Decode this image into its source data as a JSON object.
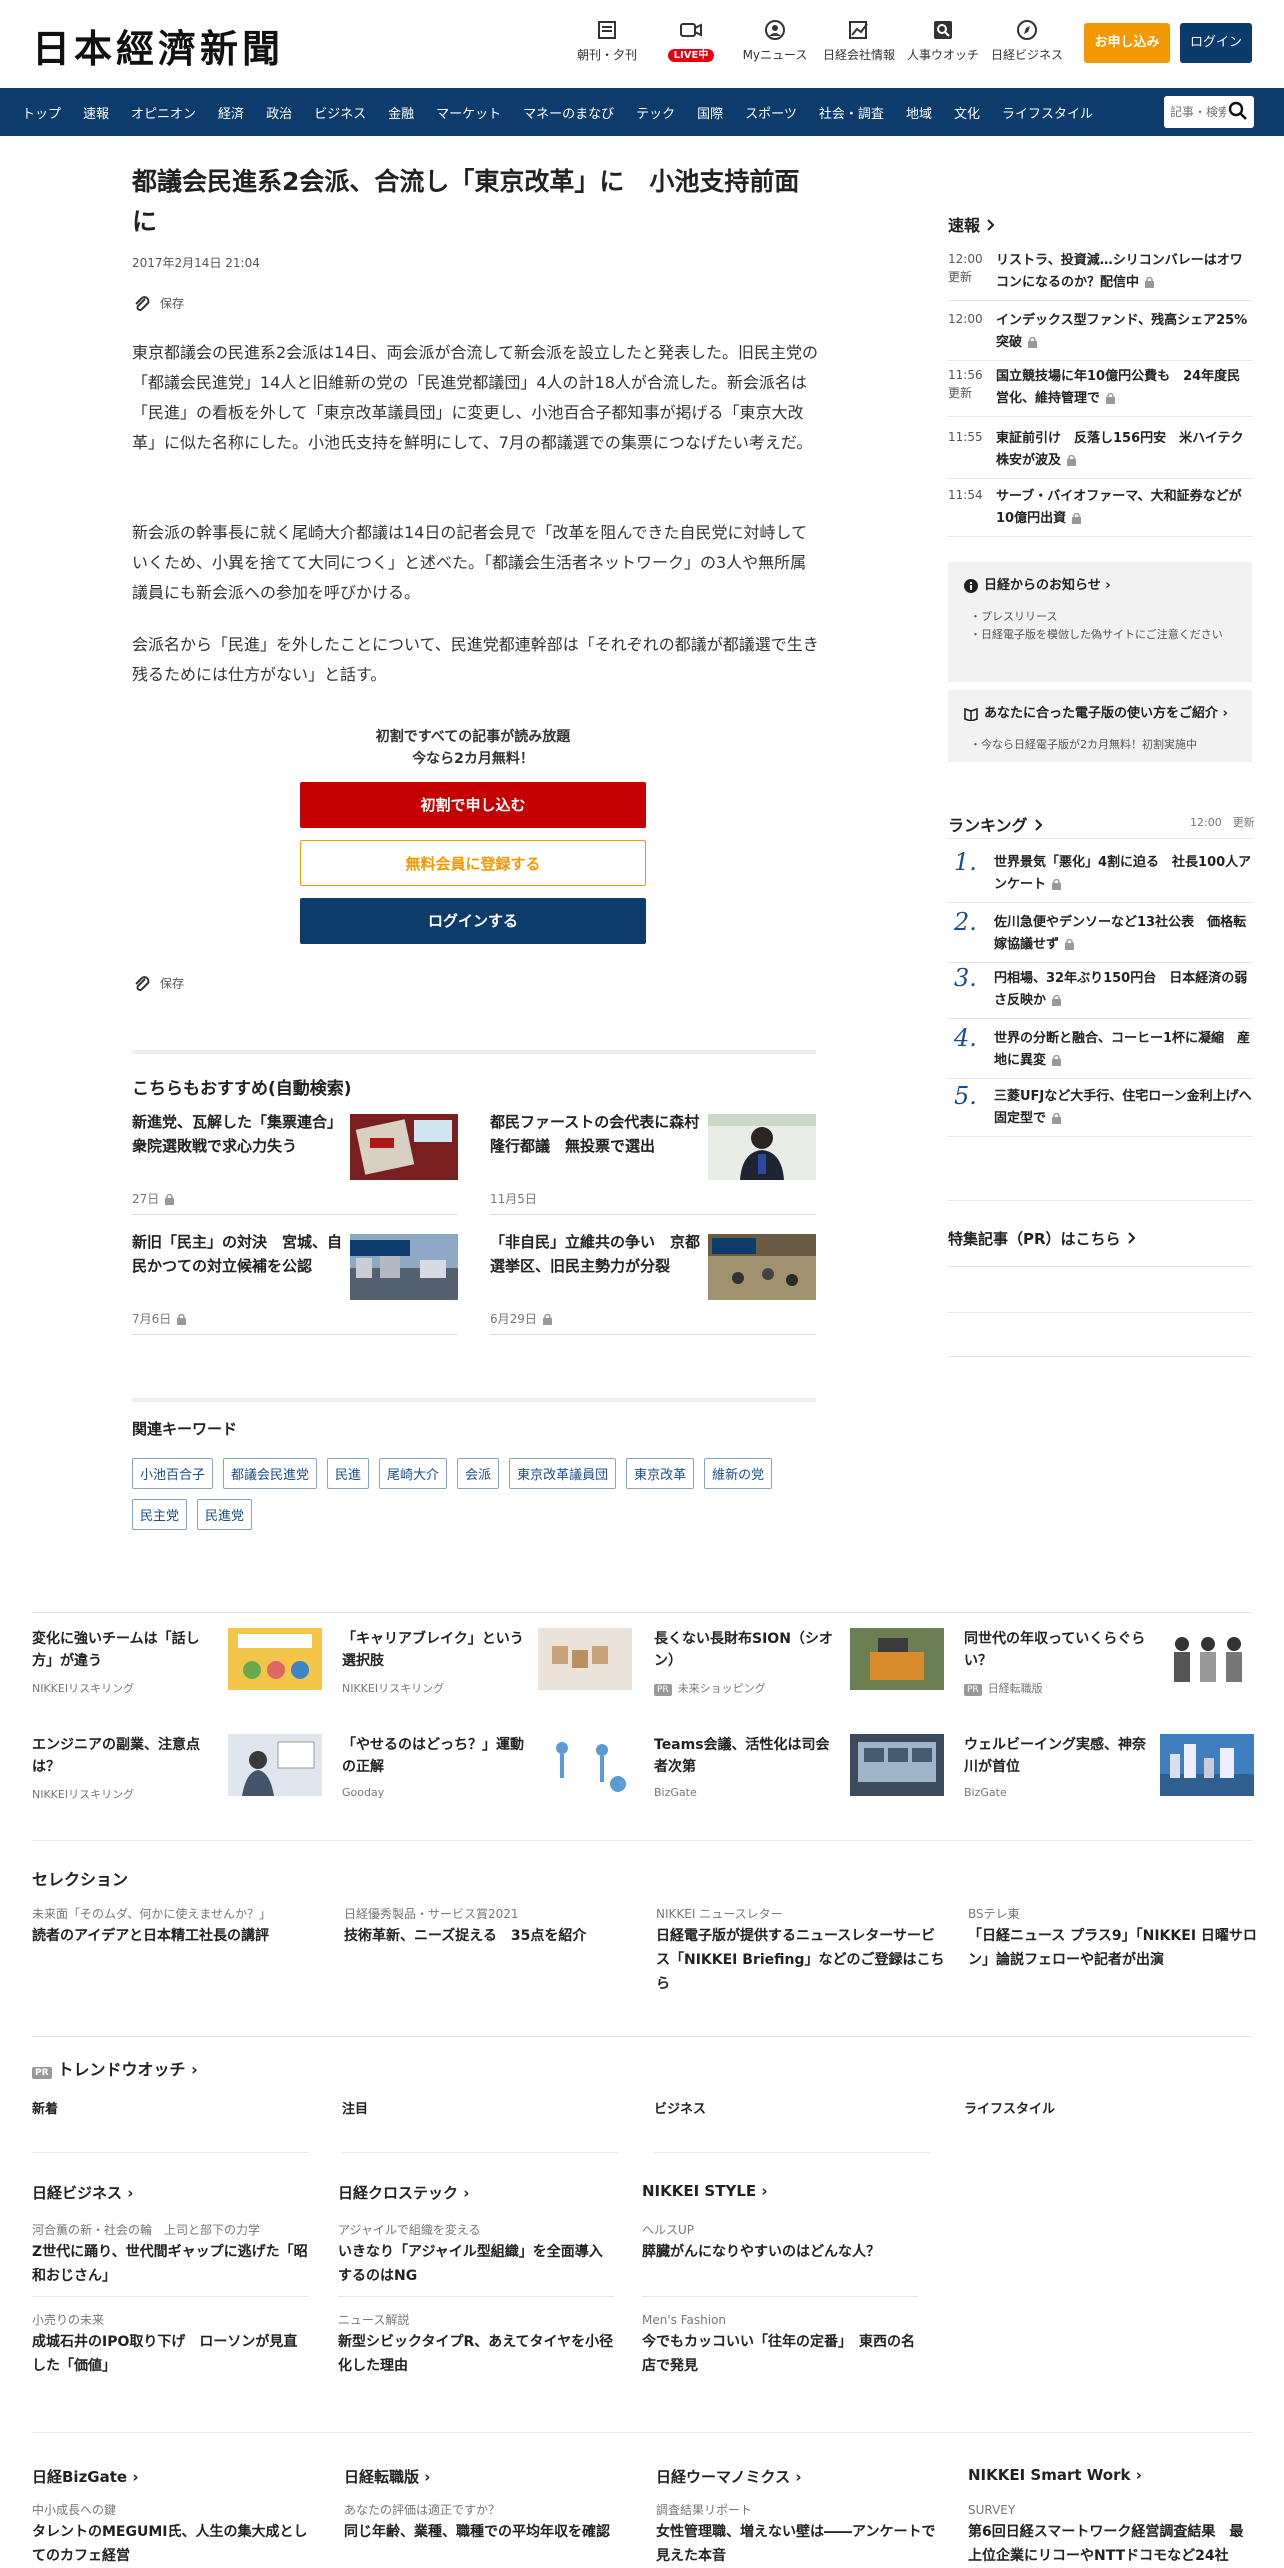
{
  "header": {
    "logo": "日本經濟新聞",
    "icons": [
      {
        "label": "朝刊・夕刊",
        "icon": "newspaper-icon"
      },
      {
        "label": "LIVE中",
        "icon": "video-icon"
      },
      {
        "label": "Myニュース",
        "icon": "user-icon"
      },
      {
        "label": "日経会社情報",
        "icon": "chart-icon"
      },
      {
        "label": "人事ウオッチ",
        "icon": "search-person-icon"
      },
      {
        "label": "日経ビジネス",
        "icon": "compass-icon"
      }
    ],
    "subscribe_label": "お申し込み",
    "login_label": "ログイン"
  },
  "nav": {
    "items": [
      "トップ",
      "速報",
      "オピニオン",
      "経済",
      "政治",
      "ビジネス",
      "金融",
      "マーケット",
      "マネーのまなび",
      "テック",
      "国際",
      "スポーツ",
      "社会・調査",
      "地域",
      "文化",
      "ライフスタイル"
    ],
    "search_placeholder": "記事・検索"
  },
  "article": {
    "title": "都議会民進系2会派、合流し「東京改革」に　小池支持前面に",
    "date": "2017年2月14日 21:04",
    "save_label": "保存",
    "paragraphs": [
      "東京都議会の民進系2会派は14日、両会派が合流して新会派を設立したと発表した。旧民主党の「都議会民進党」14人と旧維新の党の「民進党都議団」4人の計18人が合流した。新会派名は「民進」の看板を外して「東京改革議員団」に変更し、小池百合子都知事が掲げる「東京大改革」に似た名称にした。小池氏支持を鮮明にして、7月の都議選での集票につなげたい考えだ。",
      "新会派の幹事長に就く尾崎大介都議は14日の記者会見で「改革を阻んできた自民党に対峙していくため、小異を捨てて大同につく」と述べた。「都議会生活者ネットワーク」の3人や無所属議員にも新会派への参加を呼びかける。",
      "会派名から「民進」を外したことについて、民進党都連幹部は「それぞれの都議が都議選で生き残るためには仕方がない」と話す。"
    ]
  },
  "paywall": {
    "lead_1": "初割ですべての記事が読み放題",
    "lead_2": "今なら2カ月無料！",
    "subscribe": "初割で申し込む",
    "register": "無料会員に登録する",
    "login": "ログインする"
  },
  "recommend": {
    "heading": "こちらもおすすめ(自動検索)",
    "items": [
      {
        "title": "新進党、瓦解した「集票連合」　衆院選敗戦で求心力失う",
        "date": "27日"
      },
      {
        "title": "都民ファーストの会代表に森村隆行都議　無投票で選出",
        "date": "11月5日"
      },
      {
        "title": "新旧「民主」の対決　宮城、自民かつての対立候補を公認",
        "date": "7月6日"
      },
      {
        "title": "「非自民」立維共の争い　京都選挙区、旧民主勢力が分裂",
        "date": "6月29日"
      }
    ]
  },
  "keywords": {
    "heading": "関連キーワード",
    "items": [
      "小池百合子",
      "都議会民進党",
      "民進",
      "尾崎大介",
      "会派",
      "東京改革議員団",
      "東京改革",
      "維新の党",
      "民主党",
      "民進党"
    ]
  },
  "sidebar": {
    "flash_heading": "速報",
    "flash": [
      {
        "time": "12:00",
        "sub": "更新",
        "title": "リストラ、投資減…シリコンバレーはオワコンになるのか？配信中"
      },
      {
        "time": "12:00",
        "sub": "",
        "title": "インデックス型ファンド、残高シェア25%突破"
      },
      {
        "time": "11:56",
        "sub": "更新",
        "title": "国立競技場に年10億円公費も　24年度民営化、維持管理で"
      },
      {
        "time": "11:55",
        "sub": "",
        "title": "東証前引け　反落し156円安　米ハイテク株安が波及"
      },
      {
        "time": "11:54",
        "sub": "",
        "title": "サーブ・バイオファーマ、大和証券などが10億円出資"
      }
    ],
    "notice_heading": "日経からのお知らせ",
    "notices": [
      "プレスリリース",
      "日経電子版を模倣した偽サイトにご注意ください"
    ],
    "guide_heading": "あなたに合った電子版の使い方をご紹介",
    "guide_items": [
      "今なら日経電子版が2カ月無料！初割実施中"
    ],
    "ranking_heading": "ランキング",
    "ranking_time": "12:00　更新",
    "ranking": [
      {
        "n": "1.",
        "title": "世界景気「悪化」4割に迫る　社長100人アンケート"
      },
      {
        "n": "2.",
        "title": "佐川急便やデンソーなど13社公表　価格転嫁協議せず"
      },
      {
        "n": "3.",
        "title": "円相場、32年ぶり150円台　日本経済の弱さ反映か"
      },
      {
        "n": "4.",
        "title": "世界の分断と融合、コーヒー1杯に凝縮　産地に異変"
      },
      {
        "n": "5.",
        "title": "三菱UFJなど大手行、住宅ローン金利上げへ　固定型で"
      }
    ],
    "special_heading": "特集記事（PR）はこちら"
  },
  "ads": [
    {
      "title": "変化に強いチームは「話し方」が違う",
      "source": "NIKKEIリスキリング",
      "pr": false
    },
    {
      "title": "「キャリアブレイク」という選択肢",
      "source": "NIKKEIリスキリング",
      "pr": false
    },
    {
      "title": "長くない長財布SION（シオン）",
      "source": "未来ショッピング",
      "pr": true
    },
    {
      "title": "同世代の年収っていくらぐらい？",
      "source": "日経転職版",
      "pr": true
    },
    {
      "title": "エンジニアの副業、注意点は？",
      "source": "NIKKEIリスキリング",
      "pr": false
    },
    {
      "title": "「やせるのはどっち？」運動の正解",
      "source": "Gooday",
      "pr": false
    },
    {
      "title": "Teams会議、活性化は司会者次第",
      "source": "BizGate",
      "pr": false
    },
    {
      "title": "ウェルビーイング実感、神奈川が首位",
      "source": "BizGate",
      "pr": false
    }
  ],
  "selection": {
    "heading": "セレクション",
    "items": [
      {
        "kicker": "未来面「そのムダ、何かに使えませんか？」",
        "title": "読者のアイデアと日本精工社長の講評"
      },
      {
        "kicker": "日経優秀製品・サービス賞2021",
        "title": "技術革新、ニーズ捉える　35点を紹介"
      },
      {
        "kicker": "NIKKEI ニュースレター",
        "title": "日経電子版が提供するニュースレターサービス「NIKKEI Briefing」などのご登録はこちら"
      },
      {
        "kicker": "BSテレ東",
        "title": "「日経ニュース プラス9」「NIKKEI 日曜サロン」論説フェローや記者が出演"
      }
    ]
  },
  "trend": {
    "pr": "PR",
    "heading": "トレンドウオッチ",
    "tabs": [
      "新着",
      "注目",
      "ビジネス",
      "ライフスタイル"
    ]
  },
  "media1": [
    {
      "heading": "日経ビジネス",
      "items": [
        {
          "kicker": "河合薫の新・社会の輪　上司と部下の力学",
          "title": "Z世代に踊り、世代間ギャップに逃げた「昭和おじさん」"
        },
        {
          "kicker": "小売りの未来",
          "title": "成城石井のIPO取り下げ　ローソンが見直した「価値」"
        }
      ]
    },
    {
      "heading": "日経クロステック",
      "items": [
        {
          "kicker": "アジャイルで組織を変える",
          "title": "いきなり「アジャイル型組織」を全面導入するのはNG"
        },
        {
          "kicker": "ニュース解説",
          "title": "新型シビックタイプR、あえてタイヤを小径化した理由"
        }
      ]
    },
    {
      "heading": "NIKKEI STYLE",
      "items": [
        {
          "kicker": "ヘルスUP",
          "title": "膵臓がんになりやすいのはどんな人？"
        },
        {
          "kicker": "Men's Fashion",
          "title": "今でもカッコいい「往年の定番」　東西の名店で発見"
        }
      ]
    }
  ],
  "media2": [
    {
      "heading": "日経BizGate",
      "kicker": "中小成長への鍵",
      "title": "タレントのMEGUMI氏、人生の集大成としてのカフェ経営"
    },
    {
      "heading": "日経転職版",
      "kicker": "あなたの評価は適正ですか？",
      "title": "同じ年齢、業種、職種での平均年収を確認"
    },
    {
      "heading": "日経ウーマノミクス",
      "kicker": "調査結果リポート",
      "title": "女性管理職、増えない壁は――アンケートで見えた本音"
    },
    {
      "heading": "NIKKEI Smart Work",
      "kicker": "SURVEY",
      "title": "第6回日経スマートワーク経営調査結果　最上位企業にリコーやNTTドコモなど24社"
    }
  ],
  "colors": {
    "navy": "#0d3b6b",
    "orange": "#f39800",
    "red": "#c40000",
    "live": "#e60012"
  }
}
